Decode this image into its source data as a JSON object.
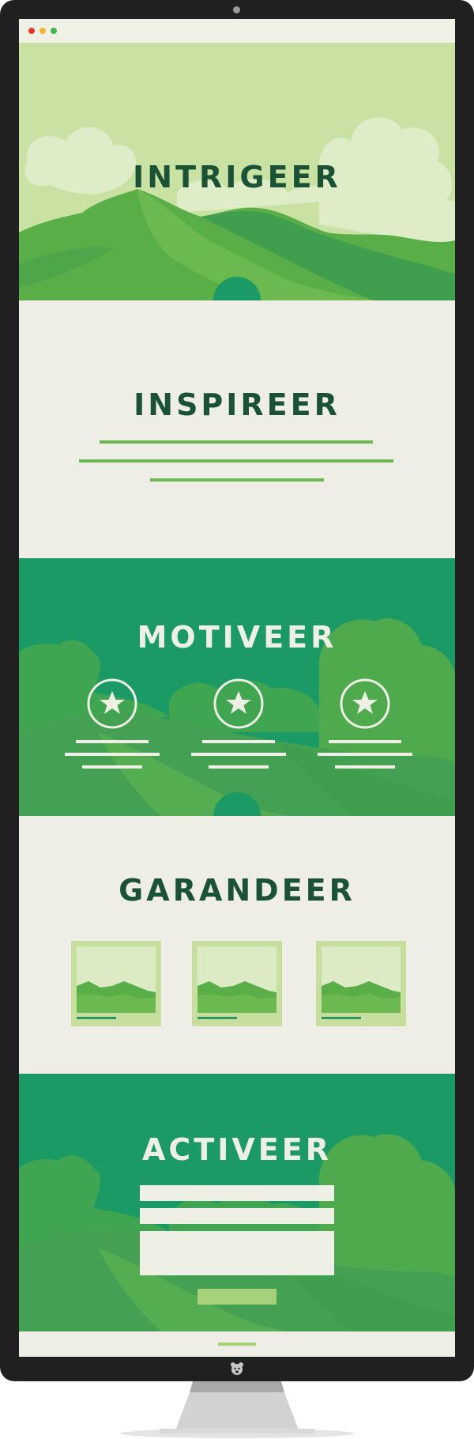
{
  "window": {
    "controls": [
      "close",
      "minimize",
      "maximize"
    ],
    "control_colors": [
      "#e8362f",
      "#f4b43a",
      "#42b649"
    ]
  },
  "sections": {
    "intrigeer": {
      "title": "INTRIGEER",
      "color": "#c9e1a3"
    },
    "inspireer": {
      "title": "INSPIREER",
      "lines": 3,
      "line_color": "#6cb94f"
    },
    "motiveer": {
      "title": "MOTIVEER",
      "features": [
        "star",
        "star",
        "star"
      ],
      "color": "#1b9a66"
    },
    "garandeer": {
      "title": "GARANDEER",
      "gallery": [
        "image",
        "image",
        "image"
      ]
    },
    "activeer": {
      "title": "ACTIVEER",
      "form_fields": [
        "text",
        "text",
        "textarea"
      ],
      "submit": "button"
    }
  },
  "icons": {
    "chevron": "chevron-down-icon",
    "star": "star-icon",
    "brand": "bear-logo-icon"
  },
  "colors": {
    "dark_green": "#1b5236",
    "mid_green": "#1b9a66",
    "light_green": "#a7d27a",
    "cream": "#eeeee6",
    "bezel": "#202020"
  }
}
